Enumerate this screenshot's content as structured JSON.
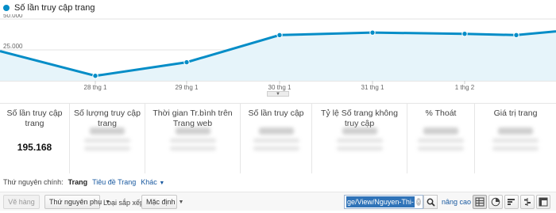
{
  "chart": {
    "legend": "Số lần truy cập trang",
    "series_color": "#058dc7",
    "fill_color": "#e6f4fa",
    "y_labels": [
      "50.000",
      "25.000"
    ],
    "x_labels": [
      "28 thg 1",
      "29 thg 1",
      "30 thg 1",
      "31 thg 1",
      "1 thg 2"
    ]
  },
  "chart_data": {
    "type": "area",
    "series": [
      {
        "name": "Số lần truy cập trang",
        "values": [
          24000,
          4000,
          15000,
          37000,
          39000,
          38000,
          37000,
          40000
        ]
      }
    ],
    "x": [
      "",
      "28 thg 1",
      "29 thg 1",
      "30 thg 1",
      "31 thg 1",
      "1 thg 2",
      "",
      ""
    ],
    "ylim": [
      0,
      50000
    ],
    "yticks": [
      "50.000",
      "25.000"
    ],
    "grid": true
  },
  "metrics": [
    {
      "label": "Số lần truy cập trang",
      "value": "195.168",
      "active": true
    },
    {
      "label": "Số lượng truy cập trang",
      "value": "",
      "active": false
    },
    {
      "label": "Thời gian Tr.bình trên Trang web",
      "value": "",
      "active": false
    },
    {
      "label": "Số lần truy cập",
      "value": "",
      "active": false
    },
    {
      "label": "Tỷ lệ Số trang không truy cập",
      "value": "",
      "active": false
    },
    {
      "label": "% Thoát",
      "value": "",
      "active": false
    },
    {
      "label": "Giá trị trang",
      "value": "",
      "active": false
    }
  ],
  "dimension": {
    "label": "Thứ nguyên chính:",
    "selected": "Trang",
    "options": [
      "Tiêu đề Trang",
      "Khác"
    ]
  },
  "toolbar": {
    "plot_rows": "Vẽ hàng",
    "secondary_dimension": "Thứ nguyên phụ",
    "sort_type_label": "Loại sắp xếp:",
    "sort_type_value": "Mặc định",
    "search_value": "ge/View/Nguyen-Thi-Hue",
    "advanced": "nâng cao"
  }
}
